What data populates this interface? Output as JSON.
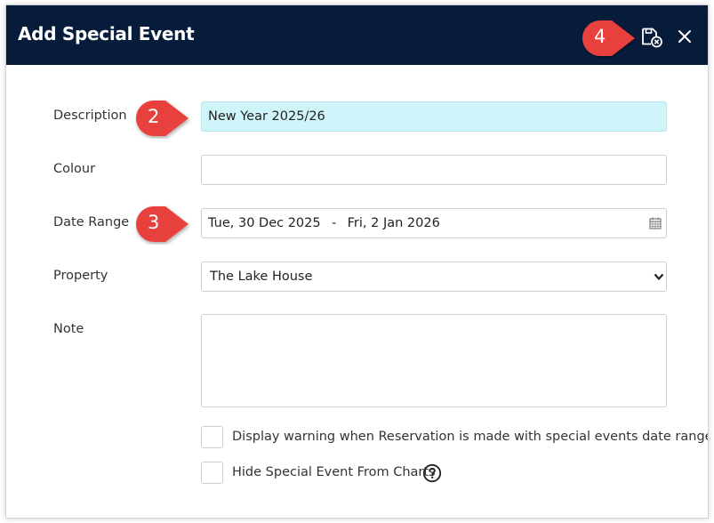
{
  "dialog": {
    "title": "Add Special Event"
  },
  "header": {
    "save_icon": "save-calendar-icon",
    "close_icon": "close-icon",
    "close_glyph": "✕"
  },
  "form": {
    "description": {
      "label": "Description",
      "value": "New Year 2025/26"
    },
    "colour": {
      "label": "Colour",
      "value": ""
    },
    "date_range": {
      "label": "Date Range",
      "start": "Tue, 30 Dec 2025",
      "separator": "-",
      "end": "Fri, 2 Jan 2026",
      "icon": "calendar-icon"
    },
    "property": {
      "label": "Property",
      "selected": "The Lake House"
    },
    "note": {
      "label": "Note",
      "value": ""
    },
    "display_warning": {
      "label": "Display warning when Reservation is made with special events date range",
      "checked": false
    },
    "hide_from_charts": {
      "label": "Hide Special Event From Charts",
      "checked": false,
      "help_icon": "question-circle-icon"
    }
  },
  "callouts": [
    {
      "number": "2",
      "color": "#e8413c"
    },
    {
      "number": "3",
      "color": "#e8413c"
    },
    {
      "number": "4",
      "color": "#e8413c"
    }
  ],
  "colors": {
    "header_bg": "#061c3a",
    "highlight_field": "#cdf5fa",
    "callout": "#e8413c"
  }
}
